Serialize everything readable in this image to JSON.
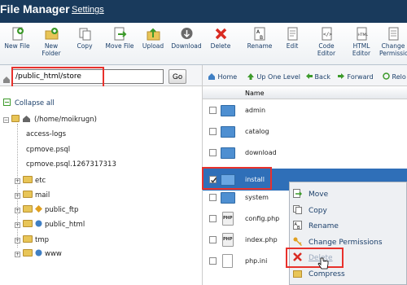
{
  "header": {
    "title": "File Manager",
    "settings": "Settings"
  },
  "toolbar": [
    {
      "label": "New File",
      "icon": "new-file-icon"
    },
    {
      "label": "New\nFolder",
      "icon": "new-folder-icon"
    },
    {
      "label": "Copy",
      "icon": "copy-icon"
    },
    {
      "label": "Move File",
      "icon": "move-file-icon"
    },
    {
      "label": "Upload",
      "icon": "upload-icon"
    },
    {
      "label": "Download",
      "icon": "download-icon"
    },
    {
      "label": "Delete",
      "icon": "delete-icon"
    },
    {
      "label": "Rename",
      "icon": "rename-icon"
    },
    {
      "label": "Edit",
      "icon": "edit-icon"
    },
    {
      "label": "Code\nEditor",
      "icon": "code-editor-icon"
    },
    {
      "label": "HTML\nEditor",
      "icon": "html-editor-icon"
    },
    {
      "label": "Change\nPermissio",
      "icon": "permissions-icon"
    }
  ],
  "path": {
    "value": "/public_html/store",
    "go": "Go"
  },
  "nav": {
    "home": "Home",
    "up": "Up One Level",
    "back": "Back",
    "forward": "Forward",
    "reload": "Relo"
  },
  "tree": {
    "collapse_all": "Collapse all",
    "root": "(/home/moikrugn)",
    "items": [
      "access-logs",
      "cpmove.psql",
      "cpmove.psql.1267317313",
      "etc",
      "mail",
      "public_ftp",
      "public_html",
      "tmp",
      "www"
    ]
  },
  "list": {
    "header": "Name",
    "rows": [
      {
        "name": "admin",
        "type": "folder",
        "checked": false
      },
      {
        "name": "catalog",
        "type": "folder",
        "checked": false
      },
      {
        "name": "download",
        "type": "folder",
        "checked": false
      },
      {
        "name": "image",
        "type": "folder",
        "checked": false
      },
      {
        "name": "install",
        "type": "folder",
        "checked": true
      },
      {
        "name": "system",
        "type": "folder",
        "checked": false
      },
      {
        "name": "config.php",
        "type": "php",
        "checked": false
      },
      {
        "name": "index.php",
        "type": "php",
        "checked": false
      },
      {
        "name": "php.ini",
        "type": "file",
        "checked": false
      }
    ]
  },
  "context_menu": [
    "Move",
    "Copy",
    "Rename",
    "Change Permissions",
    "Delete",
    "Compress"
  ],
  "colors": {
    "header_bg": "#193a5c",
    "highlight": "#e8312c",
    "selected_row": "#2f6fb8"
  }
}
